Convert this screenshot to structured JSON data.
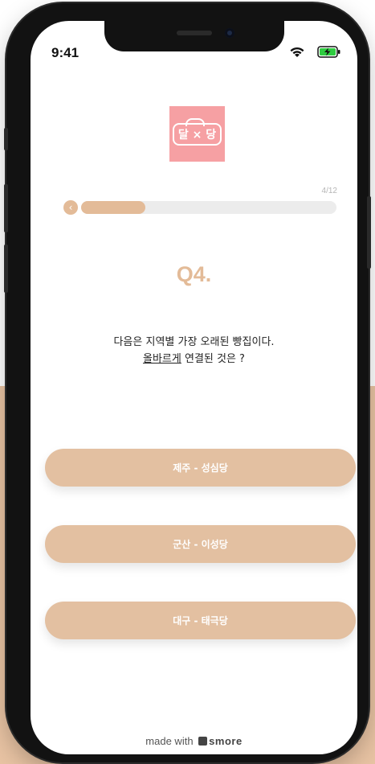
{
  "status_bar": {
    "time": "9:41"
  },
  "logo": {
    "text": "달 × 당"
  },
  "progress": {
    "count_label": "4/12",
    "fraction": 0.25,
    "back_icon": "chevron-left-icon"
  },
  "question": {
    "number": "Q4.",
    "line1": "다음은 지역별 가장 오래된 빵집이다.",
    "line2_underlined": "올바르게",
    "line2_rest": " 연결된 것은 ?"
  },
  "answers": [
    {
      "label": "제주 - 성심당"
    },
    {
      "label": "군산 - 이성당"
    },
    {
      "label": "대구 - 태극당"
    }
  ],
  "footer": {
    "prefix": "made with ",
    "brand": "smore"
  },
  "colors": {
    "accent": "#e3bb98",
    "logo_bg": "#f6a0a3",
    "battery": "#2ecc40"
  }
}
